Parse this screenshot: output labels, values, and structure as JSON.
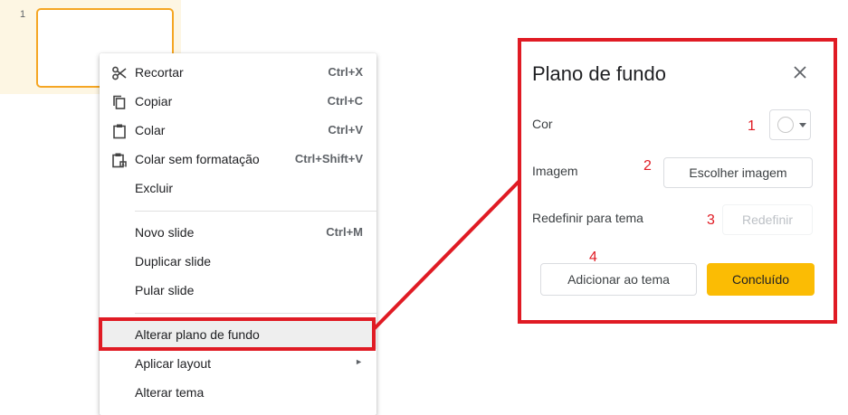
{
  "filmstrip": {
    "slide_number": "1"
  },
  "context_menu": {
    "items": [
      {
        "label": "Recortar",
        "shortcut": "Ctrl+X",
        "icon": "scissors-icon"
      },
      {
        "label": "Copiar",
        "shortcut": "Ctrl+C",
        "icon": "copy-icon"
      },
      {
        "label": "Colar",
        "shortcut": "Ctrl+V",
        "icon": "clipboard-icon"
      },
      {
        "label": "Colar sem formatação",
        "shortcut": "Ctrl+Shift+V",
        "icon": "paste-plain-icon"
      },
      {
        "label": "Excluir",
        "shortcut": ""
      },
      {
        "label": "Novo slide",
        "shortcut": "Ctrl+M"
      },
      {
        "label": "Duplicar slide",
        "shortcut": ""
      },
      {
        "label": "Pular slide",
        "shortcut": ""
      },
      {
        "label": "Alterar plano de fundo",
        "shortcut": ""
      },
      {
        "label": "Aplicar layout",
        "shortcut": "",
        "submenu_arrow": "►"
      },
      {
        "label": "Alterar tema",
        "shortcut": ""
      }
    ]
  },
  "dialog": {
    "title": "Plano de fundo",
    "color_label": "Cor",
    "image_label": "Imagem",
    "choose_image_button": "Escolher imagem",
    "reset_label": "Redefinir para tema",
    "reset_button": "Redefinir",
    "add_to_theme_button": "Adicionar ao tema",
    "done_button": "Concluído"
  },
  "annotations": [
    "1",
    "2",
    "3",
    "4"
  ],
  "colors": {
    "highlight": "#e01b24",
    "primary": "#fbbc04",
    "thumb_border": "#f5a623"
  }
}
